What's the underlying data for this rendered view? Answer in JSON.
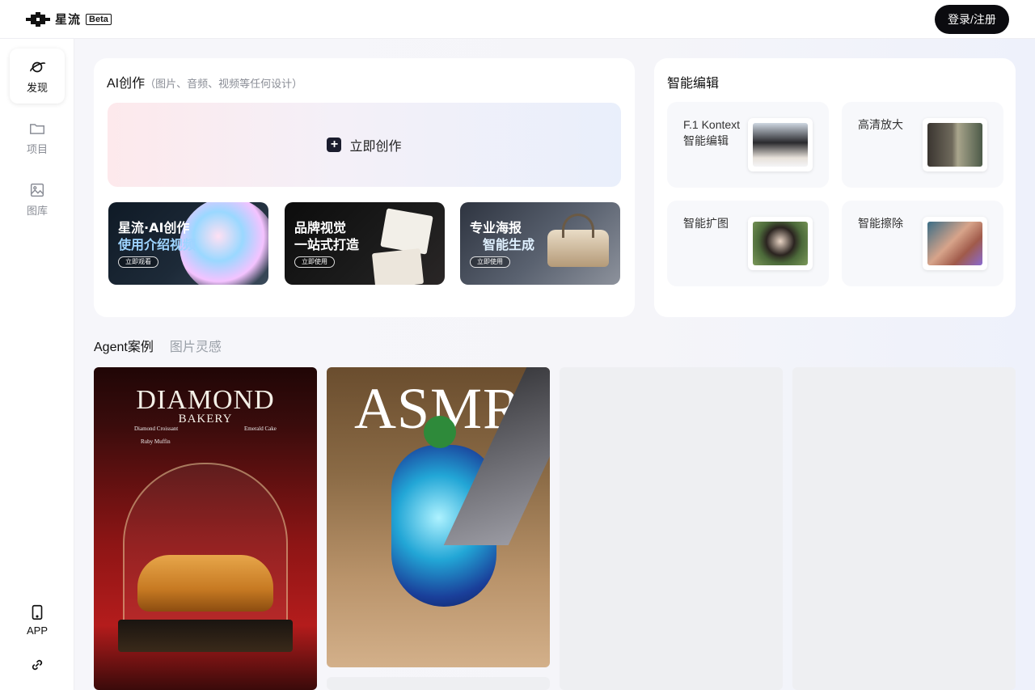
{
  "header": {
    "brand": "星流",
    "beta": "Beta",
    "login_label": "登录/注册"
  },
  "sidebar": {
    "items": [
      {
        "label": "发现",
        "icon": "planet-icon"
      },
      {
        "label": "项目",
        "icon": "folder-icon"
      },
      {
        "label": "图库",
        "icon": "image-icon"
      }
    ],
    "app_label": "APP",
    "app_icon": "tablet-icon",
    "link_icon": "link-icon"
  },
  "ai_create": {
    "title": "AI创作",
    "subtitle": "（图片、音频、视频等任何设计）",
    "create_button": "立即创作",
    "banners": [
      {
        "line1": "星流·AI创作",
        "line2": "使用介绍视频",
        "button": "立即观看"
      },
      {
        "line1": "品牌视觉",
        "line2": "一站式打造",
        "button": "立即使用"
      },
      {
        "line1": "专业海报",
        "line2": "智能生成",
        "button": "立即使用"
      }
    ]
  },
  "smart_edit": {
    "title": "智能编辑",
    "tools": [
      {
        "label_line1": "F.1 Kontext",
        "label_line2": "智能编辑"
      },
      {
        "label_line1": "高清放大",
        "label_line2": ""
      },
      {
        "label_line1": "智能扩图",
        "label_line2": ""
      },
      {
        "label_line1": "智能擦除",
        "label_line2": ""
      }
    ]
  },
  "gallery": {
    "tabs": [
      "Agent案例",
      "图片灵感"
    ],
    "items": [
      {
        "title": "DIAMOND",
        "subtitle": "BAKERY",
        "menu_left": "Diamond Croissant",
        "menu_right": "Emerald Cake",
        "menu_left2": "Ruby Muffin"
      },
      {
        "title": "ASMR"
      }
    ]
  },
  "colors": {
    "accent_dark": "#0b0b0f",
    "muted_text": "#8a8d96"
  }
}
